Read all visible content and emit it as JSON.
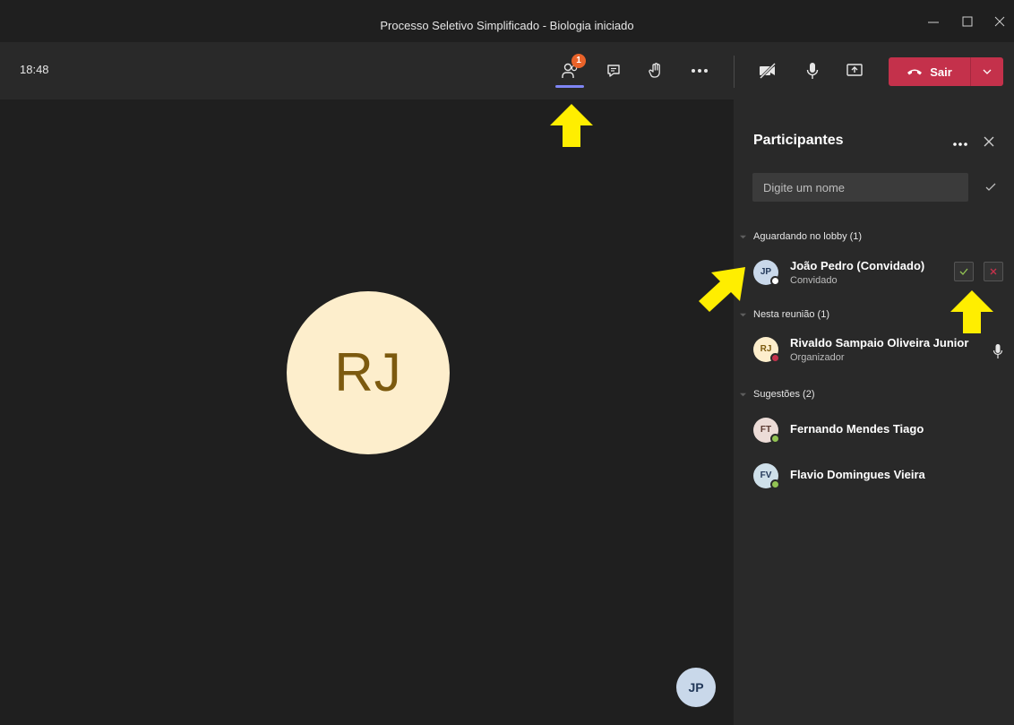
{
  "window": {
    "title": "Processo Seletivo Simplificado - Biologia iniciado",
    "controls": [
      "minimize",
      "maximize",
      "close"
    ]
  },
  "toolbar": {
    "time": "18:48",
    "participants_badge": "1",
    "leave_label": "Sair",
    "icons": [
      "people-icon",
      "chat-icon",
      "raise-hand-icon",
      "more-icon",
      "camera-off-icon",
      "mic-icon",
      "share-screen-icon",
      "phone-hangup-icon",
      "chevron-down-icon"
    ]
  },
  "stage": {
    "main_avatar_initials": "RJ",
    "self_avatar_initials": "JP"
  },
  "panel": {
    "title": "Participantes",
    "search_placeholder": "Digite um nome",
    "lobby": {
      "header": "Aguardando no lobby (1)",
      "people": [
        {
          "initials": "JP",
          "name": "João Pedro (Convidado)",
          "role": "Convidado"
        }
      ]
    },
    "meeting": {
      "header": "Nesta reunião (1)",
      "people": [
        {
          "initials": "RJ",
          "name": "Rivaldo Sampaio Oliveira Junior",
          "role": "Organizador"
        }
      ]
    },
    "suggestions": {
      "header": "Sugestões (2)",
      "people": [
        {
          "initials": "FT",
          "name": "Fernando Mendes Tiago"
        },
        {
          "initials": "FV",
          "name": "Flavio Domingues Vieira"
        }
      ]
    }
  },
  "colors": {
    "leave": "#c4314b",
    "badge": "#e9632a",
    "accent": "#7f85f5",
    "arrow": "#ffee00",
    "available": "#92c353",
    "busy": "#c4314b"
  }
}
